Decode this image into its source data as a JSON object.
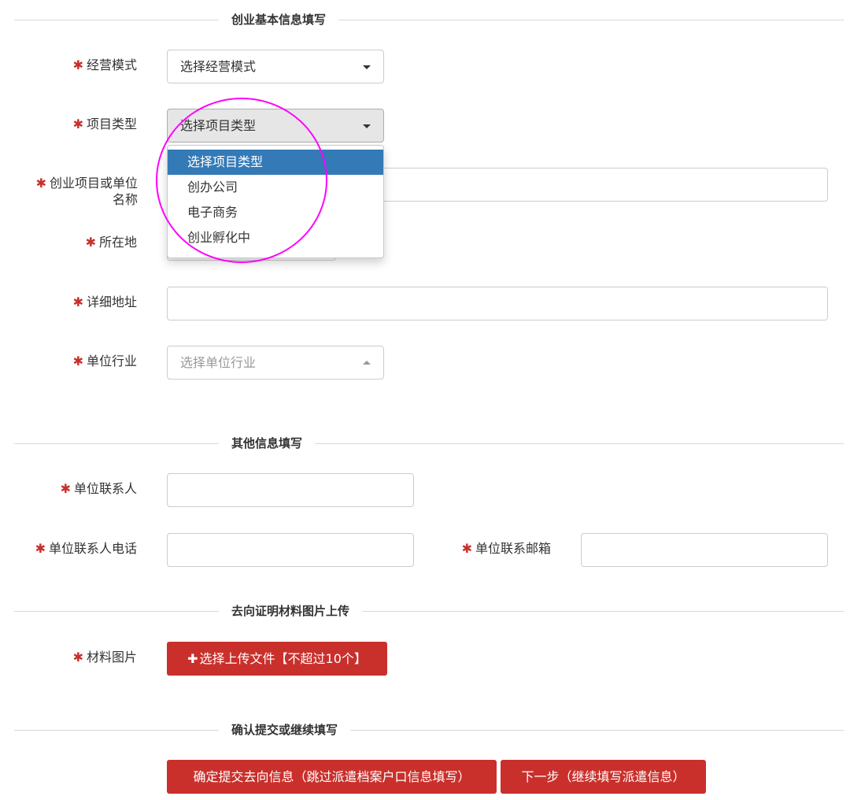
{
  "sections": {
    "basic": "创业基本信息填写",
    "other": "其他信息填写",
    "upload": "去向证明材料图片上传",
    "confirm": "确认提交或继续填写"
  },
  "required_mark": "✱",
  "fields": {
    "business_mode": {
      "label": "经营模式",
      "selected": "选择经营模式"
    },
    "project_type": {
      "label": "项目类型",
      "selected": "选择项目类型"
    },
    "project_name": {
      "label": "创业项目或单位名称"
    },
    "location": {
      "label": "所在地"
    },
    "address": {
      "label": "详细地址"
    },
    "industry": {
      "label": "单位行业",
      "placeholder": "选择单位行业"
    },
    "contact": {
      "label": "单位联系人"
    },
    "contact_phone": {
      "label": "单位联系人电话"
    },
    "contact_email": {
      "label": "单位联系邮箱"
    },
    "materials": {
      "label": "材料图片"
    }
  },
  "project_type_options": [
    "选择项目类型",
    "创办公司",
    "电子商务",
    "创业孵化中"
  ],
  "buttons": {
    "upload": "选择上传文件【不超过10个】",
    "submit": "确定提交去向信息（跳过派遣档案户口信息填写）",
    "next": "下一步（继续填写派遣信息）"
  },
  "colors": {
    "required": "#c9302c",
    "button": "#c9302c",
    "dropdown_active": "#337ab7",
    "annotation": "#ff00ff"
  }
}
